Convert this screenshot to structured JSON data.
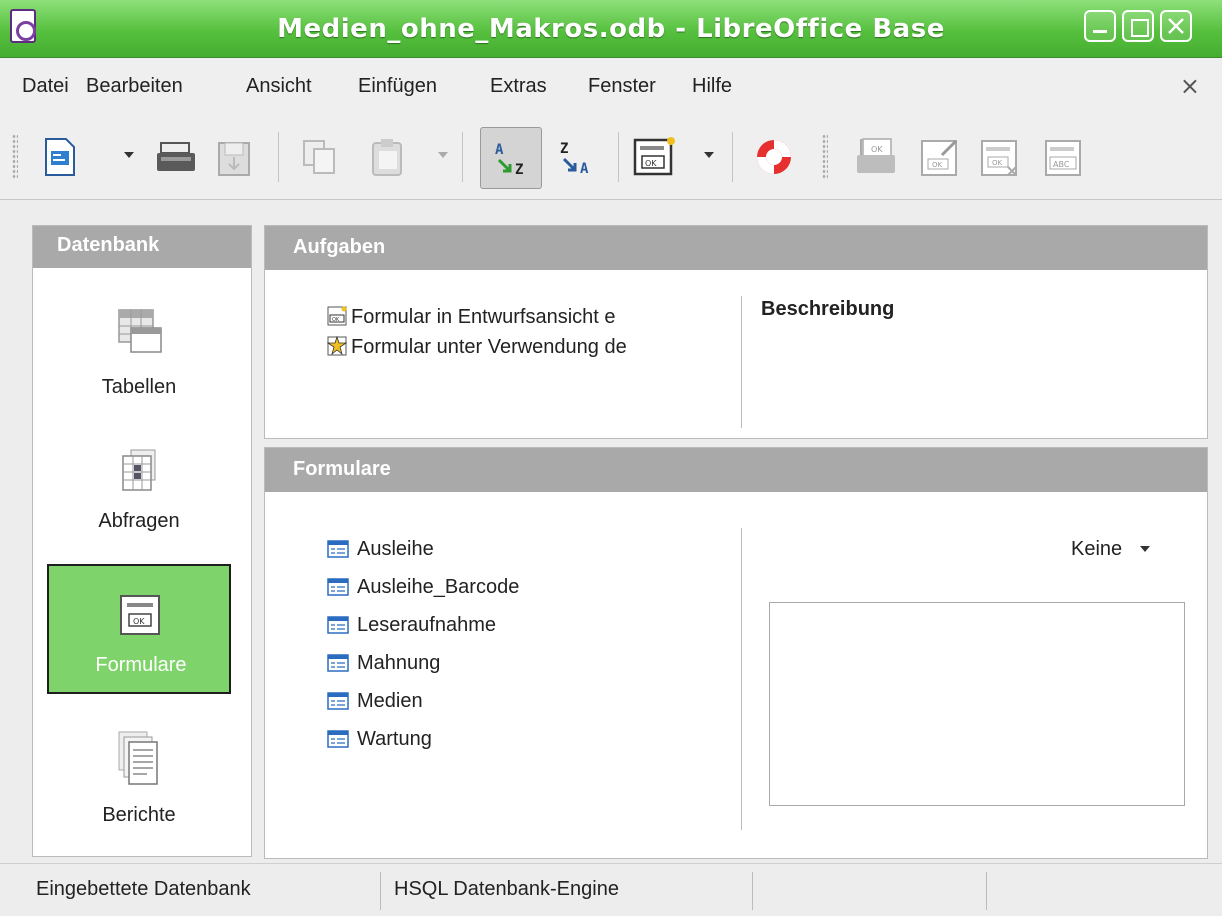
{
  "window": {
    "title": "Medien_ohne_Makros.odb - LibreOffice Base"
  },
  "menu": {
    "items": [
      "Datei",
      "Bearbeiten",
      "Ansicht",
      "Einfügen",
      "Extras",
      "Fenster",
      "Hilfe"
    ],
    "close_glyph": "×"
  },
  "toolbar": {
    "buttons": [
      "new-document-icon",
      "open-database-object-icon",
      "save-icon",
      "copy-icon",
      "paste-icon",
      "sort-ascending-icon",
      "sort-descending-icon",
      "form-icon",
      "help-icon",
      "open-icon",
      "edit-icon",
      "delete-icon",
      "rename-icon"
    ],
    "active_button": "sort-ascending-icon"
  },
  "sidebar": {
    "title": "Datenbank",
    "items": [
      {
        "label": "Tabellen",
        "icon": "tables-icon"
      },
      {
        "label": "Abfragen",
        "icon": "queries-icon"
      },
      {
        "label": "Formulare",
        "icon": "forms-icon"
      },
      {
        "label": "Berichte",
        "icon": "reports-icon"
      }
    ],
    "active": "Formulare",
    "active_color": "#7fd36b"
  },
  "tasks": {
    "title": "Aufgaben",
    "items": [
      "Formular in Entwurfsansicht e",
      "Formular unter Verwendung de"
    ],
    "description_label": "Beschreibung"
  },
  "forms": {
    "title": "Formulare",
    "items": [
      "Ausleihe",
      "Ausleihe_Barcode",
      "Leseraufnahme",
      "Mahnung",
      "Medien",
      "Wartung"
    ],
    "preview_mode": "Keine"
  },
  "status": {
    "left": "Eingebettete Datenbank",
    "middle": "HSQL Datenbank-Engine"
  },
  "colors": {
    "titlebar": "#56c03e",
    "panel_header": "#a9a9a9"
  }
}
